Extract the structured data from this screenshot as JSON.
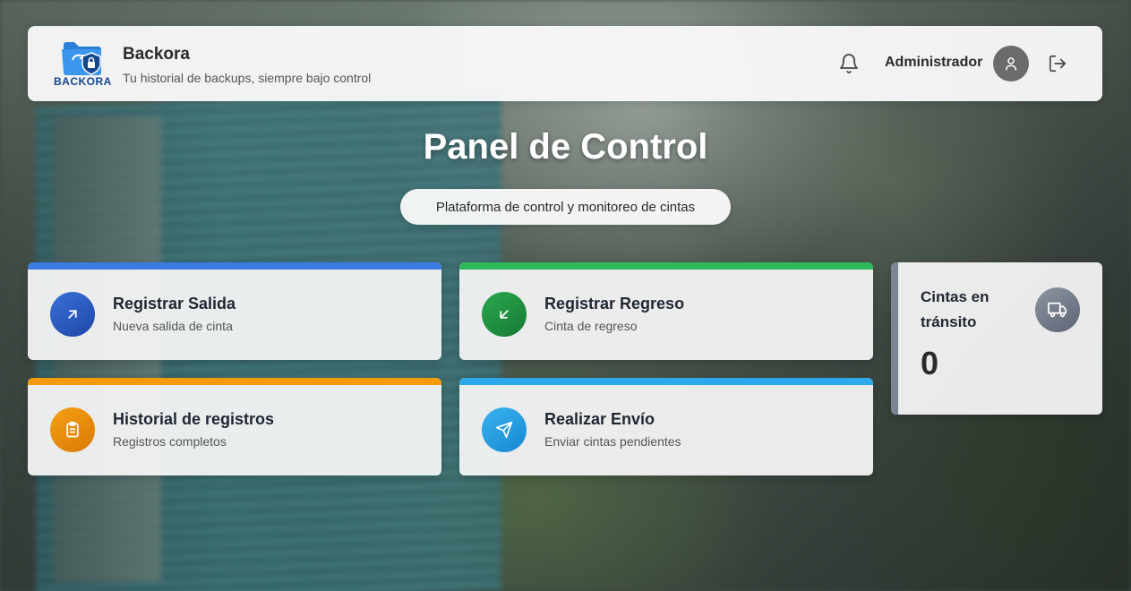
{
  "header": {
    "logo_text": "BACKORA",
    "brand_title": "Backora",
    "brand_subtitle": "Tu historial de backups, siempre bajo control",
    "user_name": "Administrador"
  },
  "main": {
    "title": "Panel de Control",
    "subtitle": "Plataforma de control y monitoreo de cintas"
  },
  "cards": [
    {
      "title": "Registrar Salida",
      "subtitle": "Nueva salida de cinta",
      "color": "#3b7ae0",
      "icon": "arrow-up-right-icon"
    },
    {
      "title": "Registrar Regreso",
      "subtitle": "Cinta de regreso",
      "color": "#2fb95a",
      "icon": "arrow-down-left-icon"
    },
    {
      "title": "Historial de registros",
      "subtitle": "Registros completos",
      "color": "#f59b0b",
      "icon": "clipboard-icon"
    },
    {
      "title": "Realizar Envío",
      "subtitle": "Enviar cintas pendientes",
      "color": "#2ba9ec",
      "icon": "send-icon"
    }
  ],
  "transit": {
    "title": "Cintas en tránsito",
    "count": "0",
    "icon": "truck-icon"
  }
}
